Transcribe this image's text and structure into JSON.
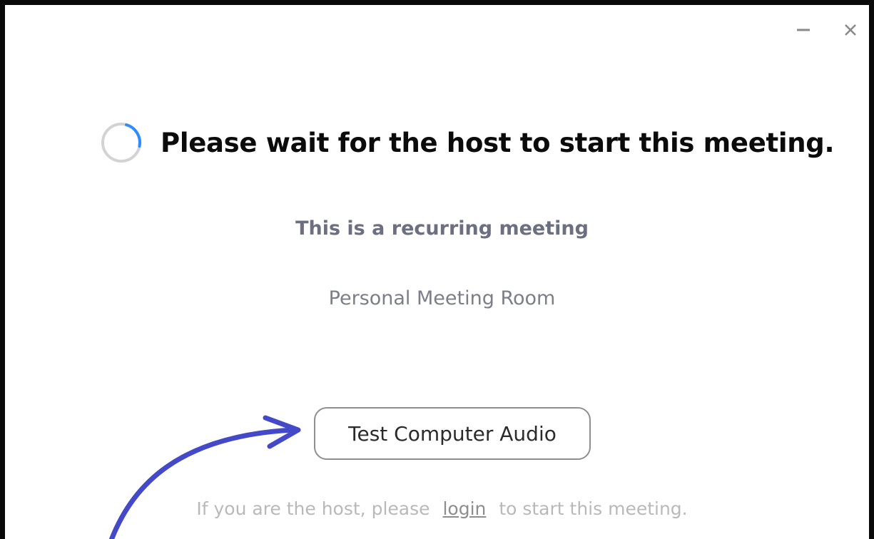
{
  "window": {
    "minimize_icon": "minimize-icon",
    "close_icon": "close-icon"
  },
  "main": {
    "title": "Please wait for the host to start this meeting.",
    "recurring_text": "This is a recurring meeting",
    "room_name": "Personal Meeting Room",
    "test_audio_label": "Test Computer Audio",
    "host_prefix": "If you are the host, please",
    "login_label": "login",
    "host_suffix": "to start this meeting."
  },
  "annotation": {
    "arrow_color": "#4449c9"
  },
  "colors": {
    "spinner_track": "#d3d3d3",
    "spinner_accent": "#2d8cff",
    "frame": "#0a0a0a"
  }
}
